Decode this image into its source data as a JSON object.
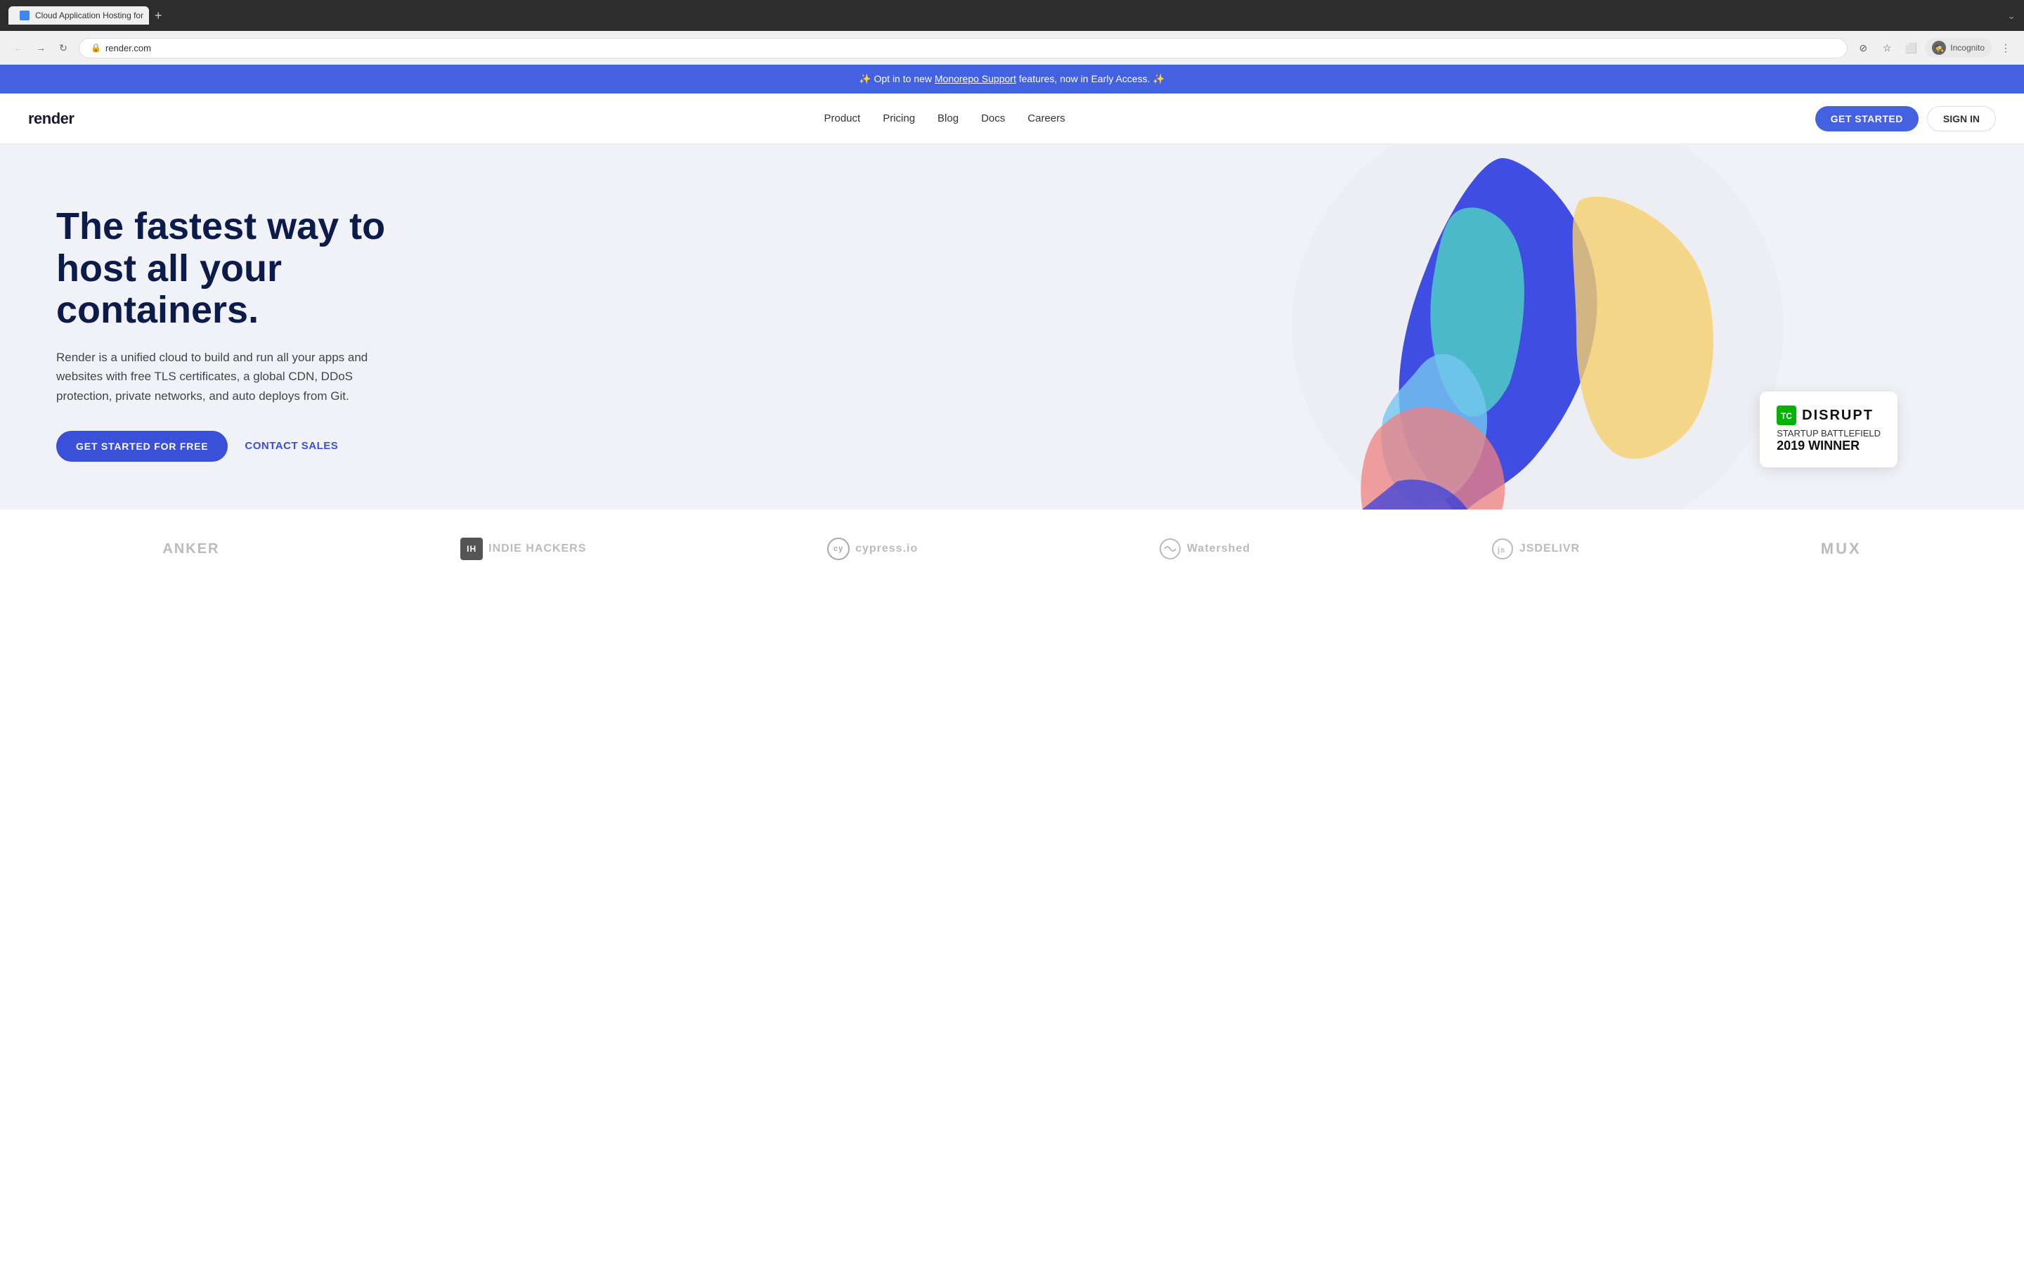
{
  "browser": {
    "tab_title": "Cloud Application Hosting for",
    "url": "render.com",
    "tab_new_label": "+",
    "incognito_label": "Incognito",
    "back_icon": "←",
    "forward_icon": "→",
    "reload_icon": "↻",
    "lock_icon": "🔒",
    "bookmark_icon": "☆",
    "menu_icon": "⋮"
  },
  "banner": {
    "text_before": "✨ Opt in to new ",
    "link_text": "Monorepo Support",
    "text_after": " features, now in Early Access. ✨"
  },
  "nav": {
    "logo": "render",
    "links": [
      {
        "label": "Product",
        "id": "product"
      },
      {
        "label": "Pricing",
        "id": "pricing"
      },
      {
        "label": "Blog",
        "id": "blog"
      },
      {
        "label": "Docs",
        "id": "docs"
      },
      {
        "label": "Careers",
        "id": "careers"
      }
    ],
    "cta_primary": "GET STARTED",
    "cta_secondary": "SIGN IN"
  },
  "hero": {
    "title": "The fastest way to host all your containers.",
    "subtitle": "Render is a unified cloud to build and run all your apps and websites with free TLS certificates, a global CDN, DDoS protection, private networks, and auto deploys from Git.",
    "cta_primary": "GET STARTED FOR FREE",
    "cta_secondary": "CONTACT SALES"
  },
  "disrupt": {
    "icon_label": "TC",
    "name": "DISRUPT",
    "subtitle": "STARTUP BATTLEFIELD",
    "winner": "2019 WINNER"
  },
  "logos": [
    {
      "id": "anker",
      "label": "ANKER",
      "icon": null
    },
    {
      "id": "indie-hackers",
      "label": "INDIE HACKERS",
      "icon": "IH"
    },
    {
      "id": "cypress",
      "label": "cypress.io",
      "icon": "cy"
    },
    {
      "id": "watershed",
      "label": "Watershed",
      "icon": "W"
    },
    {
      "id": "jsdelivr",
      "label": "JSDELIVR",
      "icon": "J"
    },
    {
      "id": "mux",
      "label": "MUX",
      "icon": null
    }
  ],
  "colors": {
    "accent": "#4361e0",
    "dark_blue": "#0d1b4b",
    "hero_bg": "#eef0f8"
  }
}
